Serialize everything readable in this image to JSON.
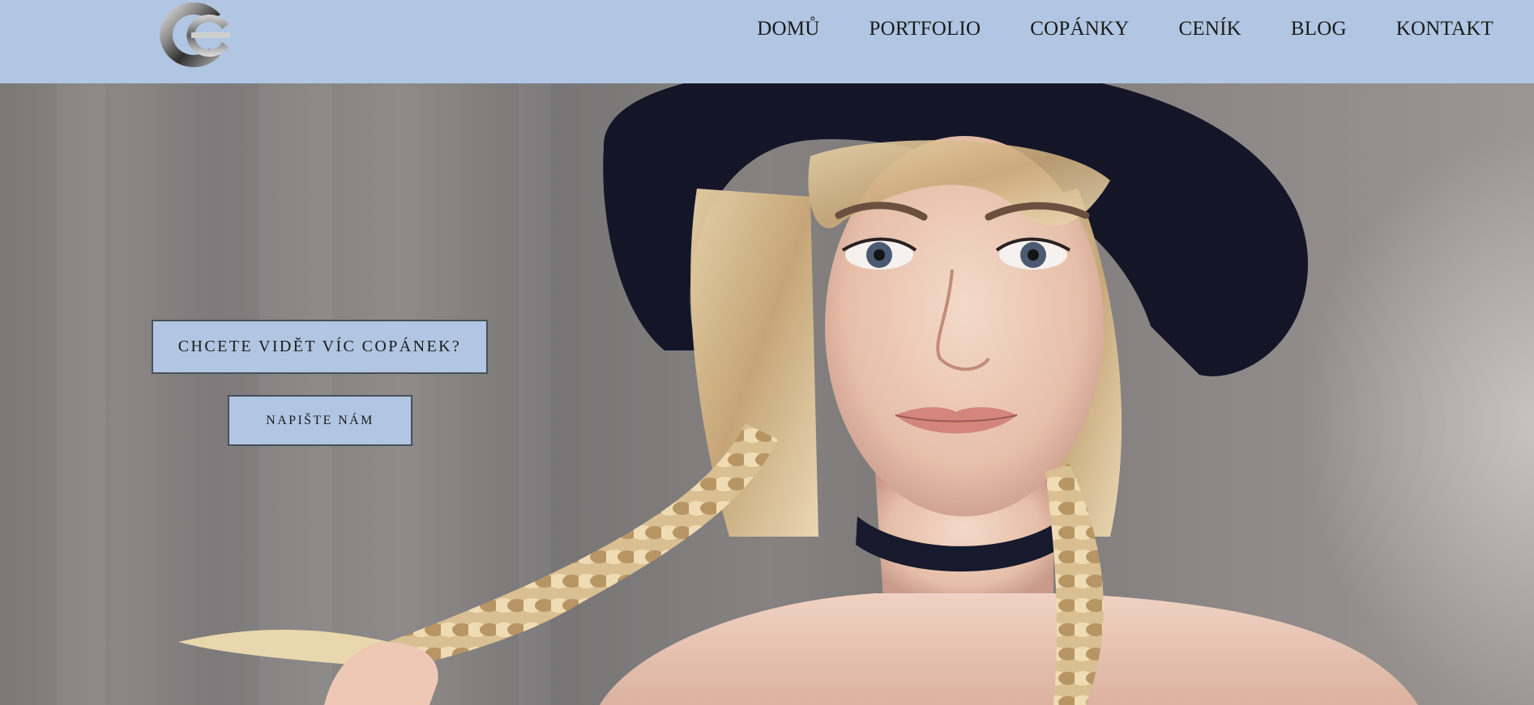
{
  "header": {
    "background": "#b1c6e2",
    "logo_icon": "c-letter-logo-icon"
  },
  "nav": {
    "items": [
      {
        "label": "DOMŮ"
      },
      {
        "label": "PORTFOLIO"
      },
      {
        "label": "COPÁNKY"
      },
      {
        "label": "CENÍK"
      },
      {
        "label": "BLOG"
      },
      {
        "label": "KONTAKT"
      }
    ]
  },
  "hero": {
    "image_icon": "hero-photo-woman-braids",
    "cta_primary": "CHCETE VIDĚT VÍC COPÁNEK?",
    "cta_secondary": "NAPIŠTE NÁM"
  },
  "colors": {
    "accent": "#b1c6e2",
    "button_border": "#4a4f5a",
    "text": "#1a1a1a"
  }
}
